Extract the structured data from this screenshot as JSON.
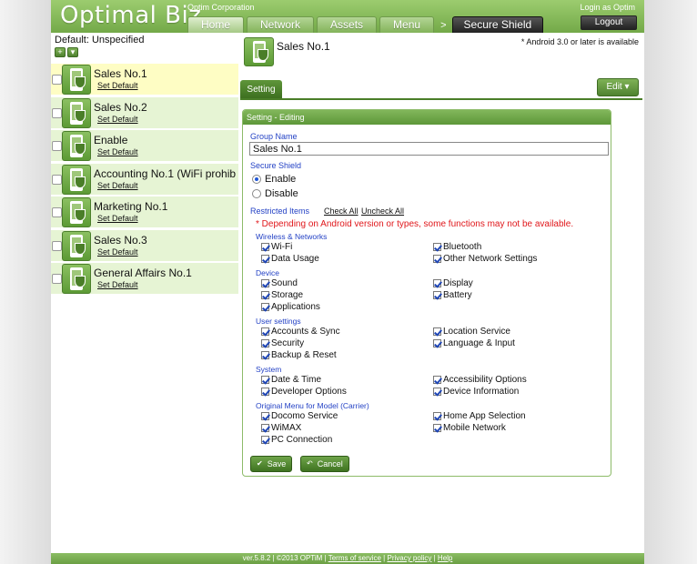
{
  "header": {
    "logo": "Optimal Biz",
    "company": "Optim Corporation",
    "login_text": "Login as  Optim",
    "logout_label": "Logout",
    "nav": [
      {
        "label": "Home"
      },
      {
        "label": "Network"
      },
      {
        "label": "Assets"
      },
      {
        "label": "Menu"
      }
    ],
    "nav_separator": ">",
    "active_tab": "Secure Shield"
  },
  "sidebar": {
    "default_label": "Default: Unspecified",
    "add_icon": "+",
    "menu_icon": "▾",
    "set_default_label": "Set Default",
    "groups": [
      {
        "name": "Sales No.1"
      },
      {
        "name": "Sales No.2"
      },
      {
        "name": "Enable"
      },
      {
        "name": "Accounting No.1 (WiFi prohibit"
      },
      {
        "name": "Marketing No.1"
      },
      {
        "name": "Sales No.3"
      },
      {
        "name": "General Affairs No.1"
      }
    ]
  },
  "main": {
    "title": "Sales No.1",
    "android_note": "* Android 3.0 or later is available",
    "tab_label": "Setting",
    "edit_label": "Edit",
    "panel_title": "Setting - Editing",
    "group_name_label": "Group Name",
    "group_name_value": "Sales No.1",
    "secure_shield_label": "Secure Shield",
    "enable_label": "Enable",
    "disable_label": "Disable",
    "restricted_label": "Restricted Items",
    "check_all": "Check All",
    "uncheck_all": "Uncheck All",
    "warning": "* Depending on Android version or types, some functions may not be available.",
    "categories": [
      {
        "name": "Wireless & Networks",
        "left": [
          "Wi-Fi",
          "Data Usage"
        ],
        "right": [
          "Bluetooth",
          "Other Network Settings"
        ]
      },
      {
        "name": "Device",
        "left": [
          "Sound",
          "Storage",
          "Applications"
        ],
        "right": [
          "Display",
          "Battery"
        ]
      },
      {
        "name": "User settings",
        "left": [
          "Accounts & Sync",
          "Security",
          "Backup & Reset"
        ],
        "right": [
          "Location Service",
          "Language & Input"
        ]
      },
      {
        "name": "System",
        "left": [
          "Date & Time",
          "Developer Options"
        ],
        "right": [
          "Accessibility Options",
          "Device Information"
        ]
      },
      {
        "name": "Original Menu for Model (Carrier)",
        "left": [
          "Docomo Service",
          "WiMAX",
          "PC Connection"
        ],
        "right": [
          "Home App Selection",
          "Mobile Network"
        ]
      }
    ],
    "save_label": "Save",
    "cancel_label": "Cancel"
  },
  "footer": {
    "version": "ver.5.8.2 | ©2013 OPTiM |",
    "terms": "Terms of service",
    "privacy": "Privacy policy",
    "help": "Help"
  },
  "colors": {
    "brand_green": "#73a948",
    "dark_green": "#4a7e28",
    "selected_row": "#fefdc4",
    "row_bg": "#e6f4d4",
    "label_blue": "#2442c5",
    "warning_red": "#e0161a"
  }
}
